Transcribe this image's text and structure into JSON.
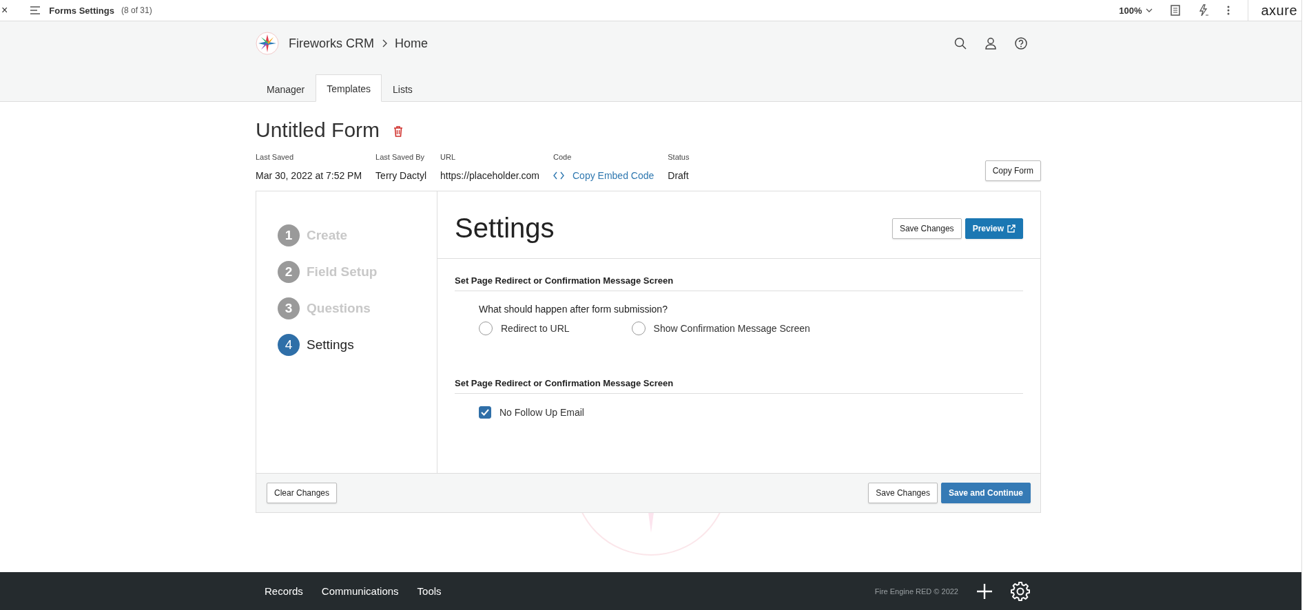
{
  "viewer_bar": {
    "close": "×",
    "title": "Forms Settings",
    "count": "(8 of 31)",
    "zoom": "100%",
    "brand": "axure"
  },
  "header": {
    "app": "Fireworks CRM",
    "crumb": "Home"
  },
  "tabs": [
    {
      "label": "Manager",
      "selected": false
    },
    {
      "label": "Templates",
      "selected": true
    },
    {
      "label": "Lists",
      "selected": false
    }
  ],
  "form": {
    "title": "Untitled Form",
    "copy_button": "Copy Form",
    "meta": [
      {
        "label": "Last Saved",
        "value": "Mar 30, 2022 at 7:52 PM",
        "kind": "text"
      },
      {
        "label": "Last Saved By",
        "value": "Terry Dactyl",
        "kind": "text"
      },
      {
        "label": "URL",
        "value": "https://placeholder.com",
        "kind": "text"
      },
      {
        "label": "Code",
        "value": "Copy Embed Code",
        "kind": "link"
      },
      {
        "label": "Status",
        "value": "Draft",
        "kind": "text"
      }
    ]
  },
  "steps": [
    {
      "number": "1",
      "label": "Create",
      "selected": false
    },
    {
      "number": "2",
      "label": "Field Setup",
      "selected": false
    },
    {
      "number": "3",
      "label": "Questions",
      "selected": false
    },
    {
      "number": "4",
      "label": "Settings",
      "selected": true
    }
  ],
  "settings": {
    "title": "Settings",
    "save_button": "Save Changes",
    "preview_button": "Preview",
    "sections": [
      {
        "heading": "Set Page Redirect or Confirmation Message Screen",
        "kind": "radio",
        "question": "What should happen after form submission?",
        "options": [
          {
            "label": "Redirect to URL",
            "selected": false
          },
          {
            "label": "Show Confirmation Message Screen",
            "selected": false
          }
        ]
      },
      {
        "heading": "Set Page Redirect or Confirmation Message Screen",
        "kind": "checkbox",
        "options": [
          {
            "label": "No Follow Up Email",
            "checked": true
          }
        ]
      }
    ]
  },
  "card_footer": {
    "clear_button": "Clear Changes",
    "save_button": "Save Changes",
    "continue_button": "Save and Continue"
  },
  "bottom_nav": {
    "items": [
      "Records",
      "Communications",
      "Tools"
    ],
    "copyright": "Fire Engine RED © 2022"
  }
}
